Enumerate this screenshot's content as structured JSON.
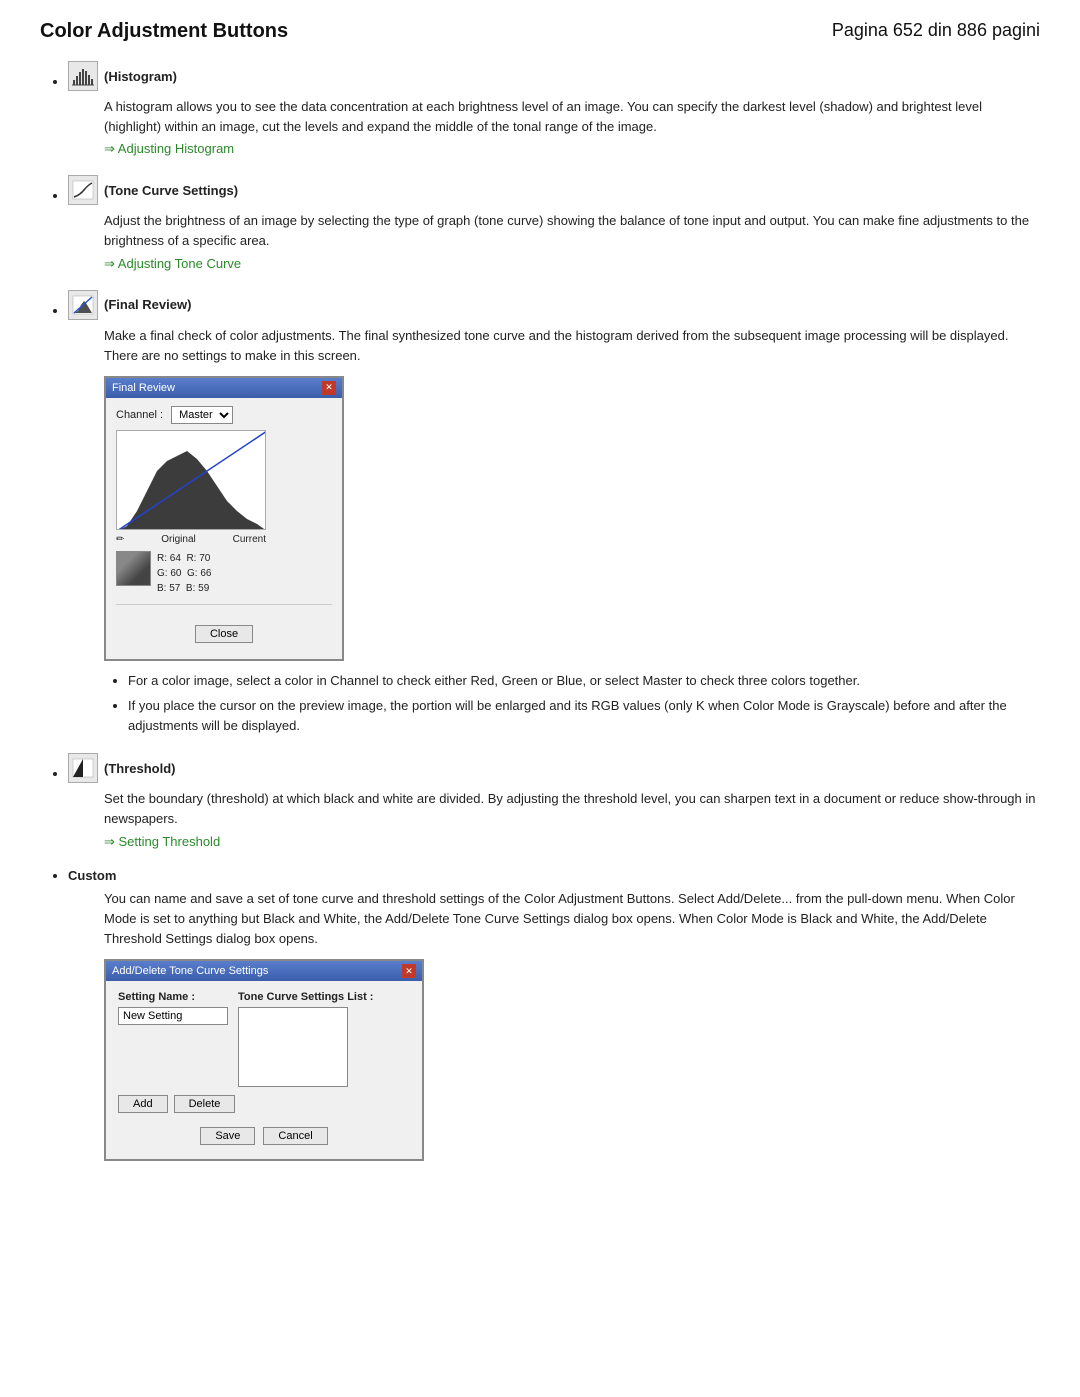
{
  "header": {
    "title": "Color Adjustment Buttons",
    "page_info": "Pagina 652 din 886 pagini"
  },
  "sections": [
    {
      "id": "histogram",
      "label": "(Histogram)",
      "icon_name": "histogram-icon",
      "body": "A histogram allows you to see the data concentration at each brightness level of an image. You can specify the darkest level (shadow) and brightest level (highlight) within an image, cut the levels and expand the middle of the tonal range of the image.",
      "link_text": "Adjusting Histogram",
      "has_link": true
    },
    {
      "id": "tone-curve",
      "label": "(Tone Curve Settings)",
      "icon_name": "tone-curve-icon",
      "body": "Adjust the brightness of an image by selecting the type of graph (tone curve) showing the balance of tone input and output. You can make fine adjustments to the brightness of a specific area.",
      "link_text": "Adjusting Tone Curve",
      "has_link": true
    },
    {
      "id": "final-review",
      "label": "(Final Review)",
      "icon_name": "final-review-icon",
      "body": "Make a final check of color adjustments. The final synthesized tone curve and the histogram derived from the subsequent image processing will be displayed. There are no settings to make in this screen.",
      "dialog": {
        "title": "Final Review",
        "channel_label": "Channel :",
        "channel_value": "Master",
        "legend_original": "Original",
        "legend_current": "Current",
        "rgb_original": {
          "r": "64",
          "g": "60",
          "b": "57"
        },
        "rgb_current": {
          "r": "70",
          "g": "66",
          "b": "59"
        },
        "close_btn": "Close"
      },
      "sub_bullets": [
        "For a color image, select a color in Channel to check either Red, Green or Blue, or select Master to check three colors together.",
        "If you place the cursor on the preview image, the portion will be enlarged and its RGB values (only K when Color Mode is Grayscale) before and after the adjustments will be displayed."
      ]
    },
    {
      "id": "threshold",
      "label": "(Threshold)",
      "icon_name": "threshold-icon",
      "body": "Set the boundary (threshold) at which black and white are divided. By adjusting the threshold level, you can sharpen text in a document or reduce show-through in newspapers.",
      "link_text": "Setting Threshold",
      "has_link": true
    },
    {
      "id": "custom",
      "label": "Custom",
      "icon_name": null,
      "body": "You can name and save a set of tone curve and threshold settings of the Color Adjustment Buttons. Select Add/Delete... from the pull-down menu. When Color Mode is set to anything but Black and White, the Add/Delete Tone Curve Settings dialog box opens. When Color Mode is Black and White, the Add/Delete Threshold Settings dialog box opens.",
      "dialog2": {
        "title": "Add/Delete Tone Curve Settings",
        "setting_name_label": "Setting Name :",
        "tone_list_label": "Tone Curve Settings List :",
        "setting_name_value": "New Setting",
        "add_btn": "Add",
        "delete_btn": "Delete",
        "save_btn": "Save",
        "cancel_btn": "Cancel"
      }
    }
  ]
}
